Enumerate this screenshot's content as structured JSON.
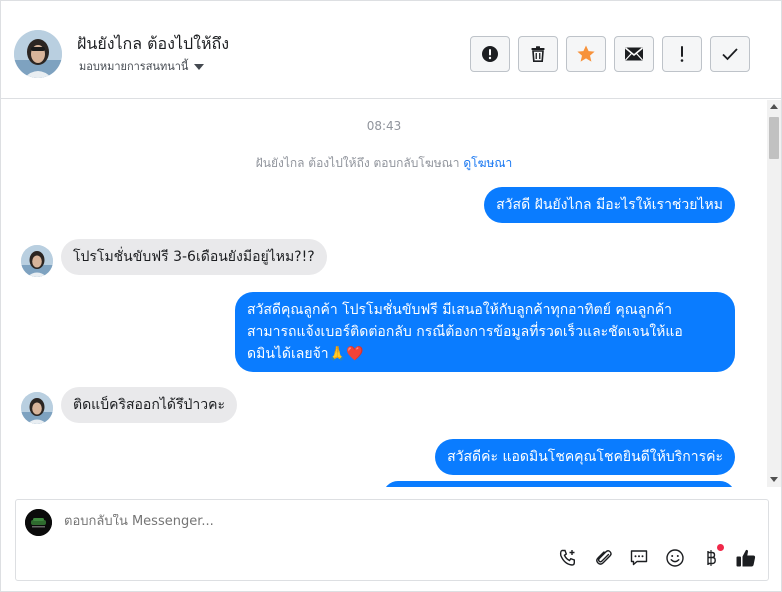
{
  "header": {
    "contact_name": "ฝันยังไกล ต้องไปให้ถึง",
    "assign_label": "มอบหมายการสนทนานี้",
    "actions": [
      {
        "name": "spam-button",
        "icon": "alert-circle-icon"
      },
      {
        "name": "delete-button",
        "icon": "trash-icon"
      },
      {
        "name": "star-button",
        "icon": "star-icon",
        "color": "#f7923b"
      },
      {
        "name": "mark-unread-button",
        "icon": "envelope-icon"
      },
      {
        "name": "follow-up-button",
        "icon": "exclamation-icon"
      },
      {
        "name": "done-button",
        "icon": "check-icon"
      }
    ]
  },
  "conversation": {
    "time": "08:43",
    "ad_notice": "ฝันยังไกล ต้องไปให้ถึง ตอบกลับโฆษณา",
    "ad_link": "ดูโฆษณา",
    "messages": [
      {
        "direction": "out",
        "text": "สวัสดี ฝันยังไกล มีอะไรให้เราช่วยไหม"
      },
      {
        "direction": "in",
        "text": "โปรโมชั่นขับฟรี 3-6เดือนยังมีอยู่ไหม?!?"
      },
      {
        "direction": "out",
        "lines": [
          "สวัสดีคุณลูกค้า โปรโมชั่นขับฟรี มีเสนอให้กับลูกค้าทุกอาทิตย์ คุณลูกค้า",
          "สามารถแจ้งเบอร์ติดต่อกลับ กรณีต้องการข้อมูลที่รวดเร็วและชัดเจนให้แอ",
          "ดมินได้เลยจ้า🙏❤️"
        ]
      },
      {
        "direction": "in",
        "text": "ติดแบ็คริสออกได้รึป่าวคะ"
      },
      {
        "direction": "out",
        "text": "สวัสดีค่ะ แอดมินโชคคุณโชคยินดีให้บริการค่ะ"
      }
    ]
  },
  "composer": {
    "placeholder": "ตอบกลับใน Messenger...",
    "tools": [
      "add-call-icon",
      "paperclip-icon",
      "saved-reply-icon",
      "emoji-icon",
      "payment-icon",
      "like-icon"
    ]
  },
  "colors": {
    "outgoing_bubble": "#0a7cff",
    "incoming_bubble": "#e9e9eb",
    "link": "#1877f2",
    "notification_dot": "#f02849"
  }
}
